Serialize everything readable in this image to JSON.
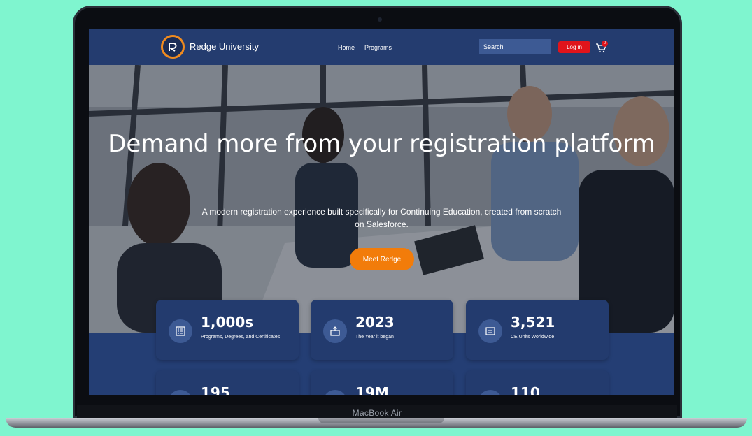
{
  "device": {
    "chin_label": "MacBook Air"
  },
  "nav": {
    "brand": "Redge University",
    "links": [
      "Home",
      "Programs"
    ],
    "search_placeholder": "Search",
    "login_label": "Log in",
    "cart_count": "0"
  },
  "hero": {
    "title": "Demand more from your registration platform",
    "subtitle": "A modern registration experience built specifically for Continuing Education, created from scratch on Salesforce.",
    "cta_label": "Meet Redge"
  },
  "stats": [
    {
      "value": "1,000s",
      "label": "Programs, Degrees, and Certificates",
      "icon": "certificate-list-icon"
    },
    {
      "value": "2023",
      "label": "The Year it began",
      "icon": "building-upload-icon"
    },
    {
      "value": "3,521",
      "label": "CE Units Worldwide",
      "icon": "id-card-icon"
    },
    {
      "value": "195",
      "label": "",
      "icon": "graduation-cap-icon"
    },
    {
      "value": "19M",
      "label": "",
      "icon": "upload-icon"
    },
    {
      "value": "110",
      "label": "",
      "icon": "monitor-icon"
    }
  ],
  "colors": {
    "background": "#7ff5cf",
    "navbar": "#243c6f",
    "login": "#e0141b",
    "cta": "#f27c0a",
    "logo_ring": "#f08b1f",
    "card": "#233b6e"
  }
}
